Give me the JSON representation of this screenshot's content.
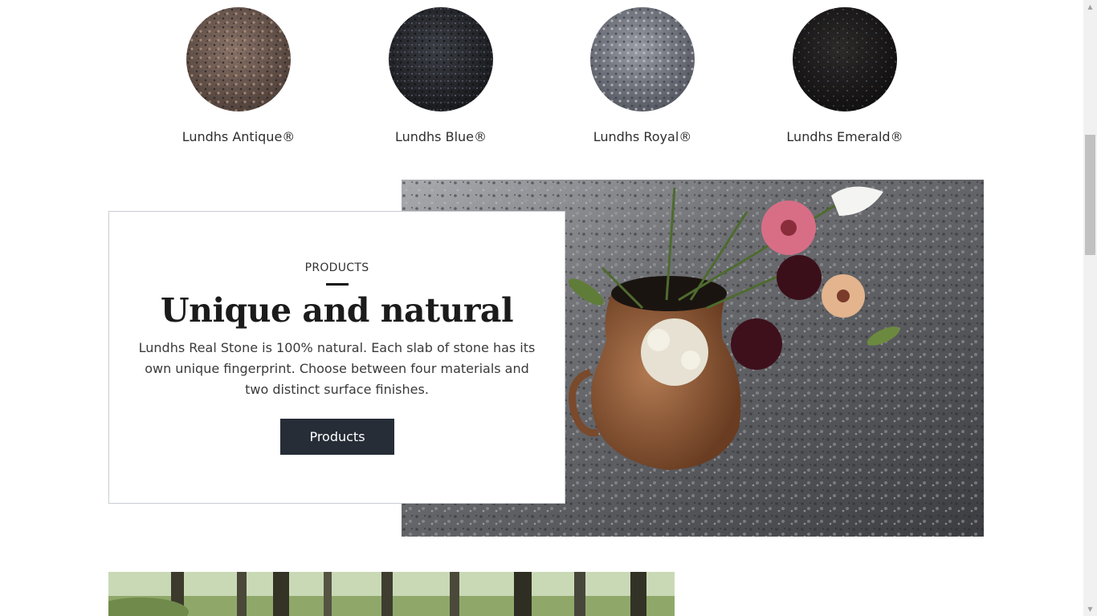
{
  "materials": [
    {
      "name": "Lundhs Antique®",
      "swatch_color": "#6e5a50"
    },
    {
      "name": "Lundhs Blue®",
      "swatch_color": "#2a2c31"
    },
    {
      "name": "Lundhs Royal®",
      "swatch_color": "#7d8089"
    },
    {
      "name": "Lundhs Emerald®",
      "swatch_color": "#1e1c1c"
    }
  ],
  "feature": {
    "eyebrow": "PRODUCTS",
    "title": "Unique and natural",
    "body": "Lundhs Real Stone is 100% natural. Each slab of stone has its own unique fingerprint. Choose between four materials and two distinct surface finishes.",
    "button_label": "Products"
  },
  "colors": {
    "button_bg": "#262d37",
    "card_border": "#c9cdd2"
  },
  "icons": {
    "scroll_up": "▲",
    "scroll_down": "▼"
  }
}
